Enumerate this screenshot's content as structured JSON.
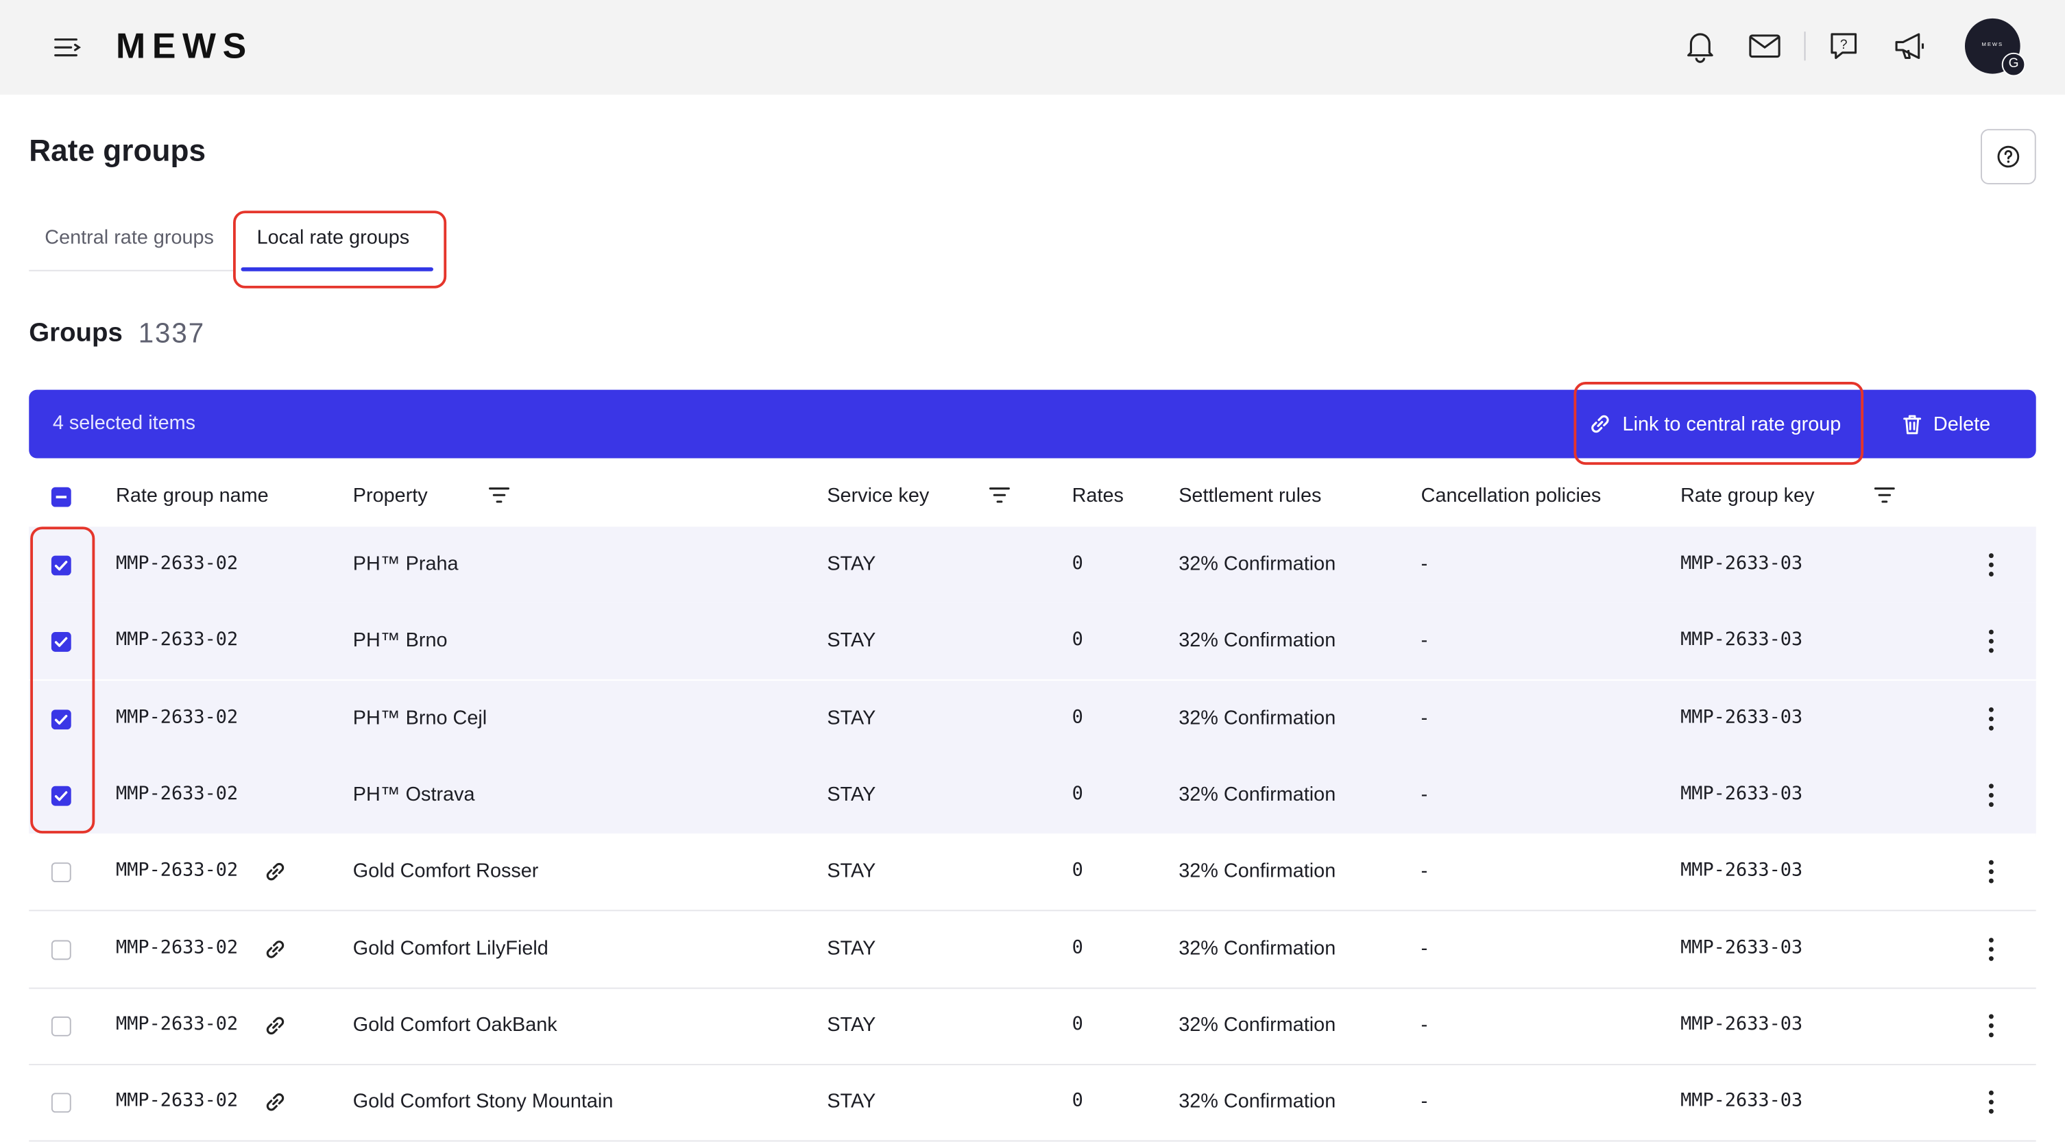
{
  "app": {
    "brand": "MEWS",
    "avatar_text": "MEWS",
    "avatar_badge": "G"
  },
  "page": {
    "title": "Rate groups"
  },
  "tabs": [
    {
      "label": "Central rate groups"
    },
    {
      "label": "Local rate groups",
      "active": true
    }
  ],
  "groups": {
    "title": "Groups",
    "count": "1337"
  },
  "selection_bar": {
    "text": "4 selected items",
    "link_label": "Link to central rate group",
    "delete_label": "Delete"
  },
  "table": {
    "columns": [
      "Rate group name",
      "Property",
      "Service key",
      "Rates",
      "Settlement rules",
      "Cancellation policies",
      "Rate group key"
    ],
    "rows": [
      {
        "name": "MMP-2633-02",
        "property": "PH™ Praha",
        "service_key": "STAY",
        "rates": "0",
        "settlement": "32% Confirmation",
        "cancellation": "-",
        "key": "MMP-2633-03",
        "checked": true,
        "linked": false
      },
      {
        "name": "MMP-2633-02",
        "property": "PH™ Brno",
        "service_key": "STAY",
        "rates": "0",
        "settlement": "32% Confirmation",
        "cancellation": "-",
        "key": "MMP-2633-03",
        "checked": true,
        "linked": false
      },
      {
        "name": "MMP-2633-02",
        "property": "PH™ Brno Cejl",
        "service_key": "STAY",
        "rates": "0",
        "settlement": "32% Confirmation",
        "cancellation": "-",
        "key": "MMP-2633-03",
        "checked": true,
        "linked": false
      },
      {
        "name": "MMP-2633-02",
        "property": "PH™ Ostrava",
        "service_key": "STAY",
        "rates": "0",
        "settlement": "32% Confirmation",
        "cancellation": "-",
        "key": "MMP-2633-03",
        "checked": true,
        "linked": false
      },
      {
        "name": "MMP-2633-02",
        "property": "Gold Comfort Rosser",
        "service_key": "STAY",
        "rates": "0",
        "settlement": "32% Confirmation",
        "cancellation": "-",
        "key": "MMP-2633-03",
        "checked": false,
        "linked": true
      },
      {
        "name": "MMP-2633-02",
        "property": "Gold Comfort LilyField",
        "service_key": "STAY",
        "rates": "0",
        "settlement": "32% Confirmation",
        "cancellation": "-",
        "key": "MMP-2633-03",
        "checked": false,
        "linked": true
      },
      {
        "name": "MMP-2633-02",
        "property": "Gold Comfort OakBank",
        "service_key": "STAY",
        "rates": "0",
        "settlement": "32% Confirmation",
        "cancellation": "-",
        "key": "MMP-2633-03",
        "checked": false,
        "linked": true
      },
      {
        "name": "MMP-2633-02",
        "property": "Gold Comfort Stony Mountain",
        "service_key": "STAY",
        "rates": "0",
        "settlement": "32% Confirmation",
        "cancellation": "-",
        "key": "MMP-2633-03",
        "checked": false,
        "linked": true
      }
    ]
  },
  "icons": [
    "menu-icon",
    "bell-icon",
    "mail-icon",
    "help-chat-icon",
    "megaphone-icon",
    "help-icon",
    "link-icon",
    "trash-icon",
    "filter-icon",
    "more-vert-icon",
    "check-icon"
  ],
  "colors": {
    "accent": "#3a36e6",
    "highlight": "#e5352b",
    "topbar": "#f3f3f3"
  }
}
